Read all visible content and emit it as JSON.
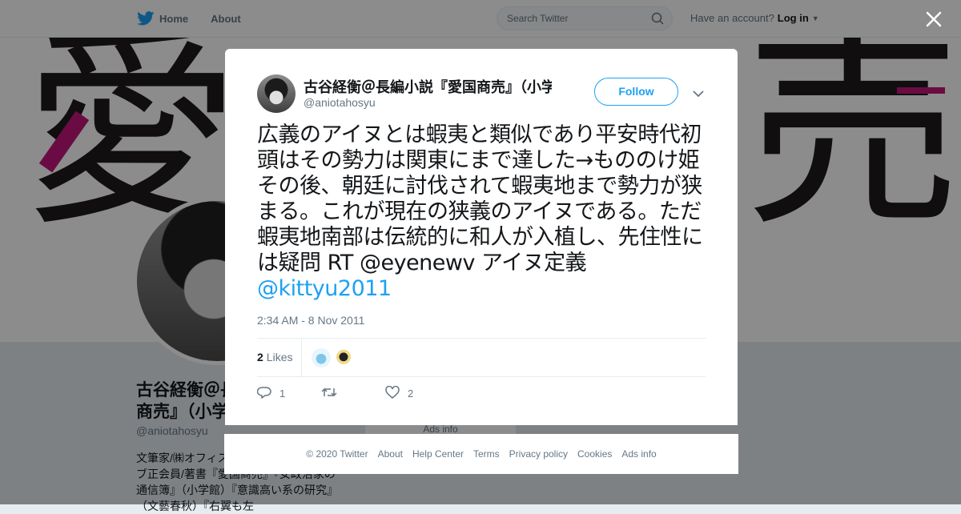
{
  "nav": {
    "home": "Home",
    "about": "About"
  },
  "search": {
    "placeholder": "Search Twitter"
  },
  "account": {
    "prompt": "Have an account?",
    "login": "Log in"
  },
  "banner": {
    "left_kanji": "愛",
    "right_kanji": "売"
  },
  "profile": {
    "name": "古谷経衡＠長編小説『愛国商売』（小学館）",
    "handle": "@aniotahosyu",
    "bio": "文筆家/㈱オフィス古谷代表/日本ペンクラブ正会員/著書『愛国商売』『女政治家の通信簿』（小学館）『意識高い系の研究』（文藝春秋）『右翼も左",
    "ads": "Ads info"
  },
  "tweet": {
    "author_name": "古谷経衡＠長編小説『愛国商売』（小学館）",
    "author_handle": "@aniotahosyu",
    "follow_label": "Follow",
    "text": "広義のアイヌとは蝦夷と類似であり平安時代初頭はその勢力は関東にまで達した→もののけ姫 その後、朝廷に討伐されて蝦夷地まで勢力が狭まる。これが現在の狭義のアイヌである。ただ蝦夷地南部は伝統的に和人が入植し、先住性には疑問 RT @eyenewv アイヌ定義 ",
    "mention": "@kittyu2011",
    "timestamp": "2:34 AM - 8 Nov 2011",
    "likes_count": "2",
    "likes_label": "Likes",
    "reply_count": "1",
    "retweet_count": "",
    "like_count": "2"
  },
  "footer": {
    "items": [
      "© 2020 Twitter",
      "About",
      "Help Center",
      "Terms",
      "Privacy policy",
      "Cookies",
      "Ads info"
    ]
  },
  "colors": {
    "accent": "#1da1f2",
    "text": "#14171a",
    "muted": "#657786",
    "banner_accent": "#c2177a"
  },
  "icons": [
    "bird-icon",
    "search-icon",
    "close-icon",
    "chevron-down-icon",
    "reply-icon",
    "retweet-icon",
    "heart-icon"
  ]
}
